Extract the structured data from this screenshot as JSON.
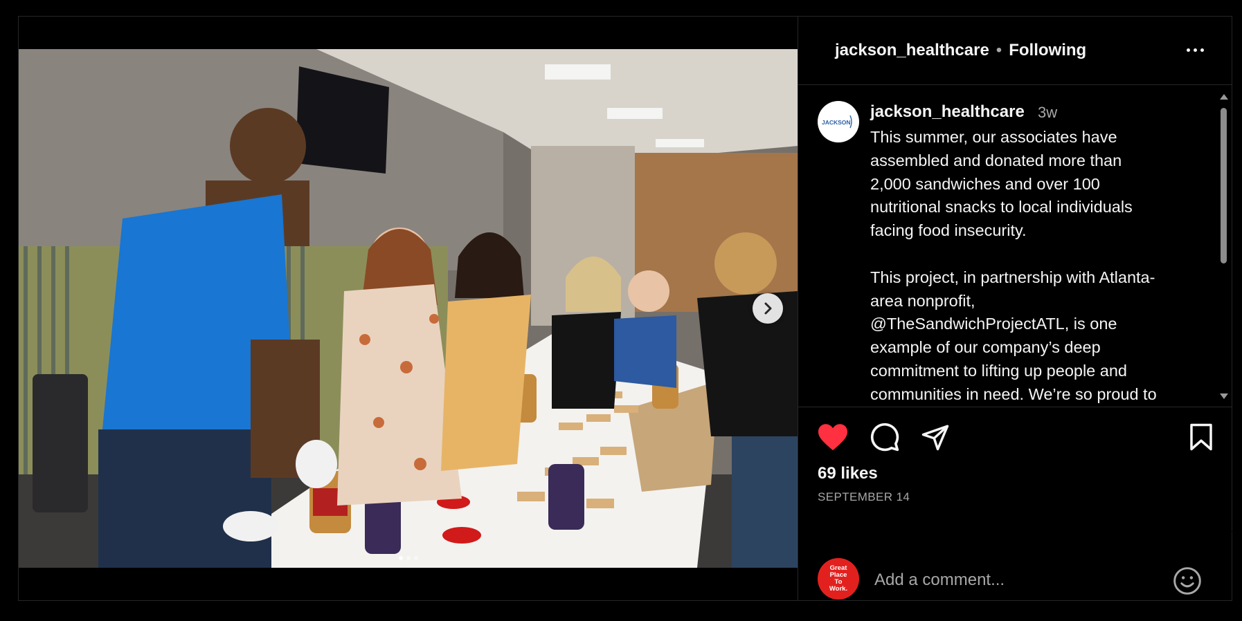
{
  "post": {
    "username": "jackson_healthcare",
    "separator": "•",
    "follow_status": "Following",
    "avatar_text": "JACKSON",
    "time_ago": "3w",
    "caption": "This summer, our associates have\nassembled and donated more than\n2,000 sandwiches and over 100\nnutritional snacks to local individuals\nfacing food insecurity.\n\nThis project, in partnership with Atlanta-\narea nonprofit,\n@TheSandwichProjectATL, is one\nexample of our company’s deep\ncommitment to lifting up people and\ncommunities in need. We’re so proud to",
    "likes": "69 likes",
    "date": "SEPTEMBER 14",
    "liked": true
  },
  "carousel": {
    "slides": 3,
    "current": 1
  },
  "comment": {
    "placeholder": "Add a comment...",
    "viewer_avatar_lines": [
      "Great",
      "Place",
      "To",
      "Work."
    ]
  },
  "icons": {
    "like": "heart-icon",
    "comment": "comment-bubble-icon",
    "share": "paper-plane-icon",
    "save": "bookmark-icon",
    "more": "more-horizontal-icon",
    "next": "chevron-right-icon",
    "emoji": "smiley-icon"
  },
  "colors": {
    "background": "#000000",
    "text": "#f5f5f5",
    "secondary_text": "#a8a8a8",
    "like_red": "#ff3040",
    "border": "#262626"
  }
}
